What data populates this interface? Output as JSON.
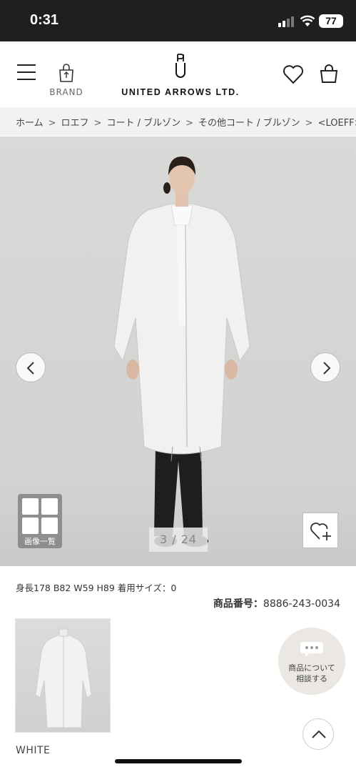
{
  "status_bar": {
    "time": "0:31",
    "battery": "77",
    "icons": [
      "cellular-signal-icon",
      "wifi-icon",
      "battery-icon"
    ]
  },
  "header": {
    "brand_label": "BRAND",
    "logo_text": "UNITED ARROWS LTD.",
    "icons": [
      "hamburger-menu-icon",
      "shopping-bag-icon",
      "heart-icon",
      "cart-bag-icon"
    ]
  },
  "breadcrumb": {
    "items": [
      "ホーム",
      "ロエフ",
      "コート / ブルゾン",
      "その他コート / ブルゾン",
      "<LOEFF>"
    ],
    "separator": ">"
  },
  "gallery": {
    "counter": "3 / 24",
    "grid_label": "画像一覧",
    "current": 3,
    "total": 24
  },
  "product": {
    "model_info": "身長178 B82 W59 H89 着用サイズ：0",
    "code_label": "商品番号：",
    "code_value": "8886-243-0034",
    "color_name": "WHITE"
  },
  "consult": {
    "line1": "商品について",
    "line2": "相談する"
  },
  "colors": {
    "status_bg": "#1f1f1f",
    "breadcrumb_bg": "#f2f2f2",
    "consult_bg": "#ebe7e3"
  }
}
